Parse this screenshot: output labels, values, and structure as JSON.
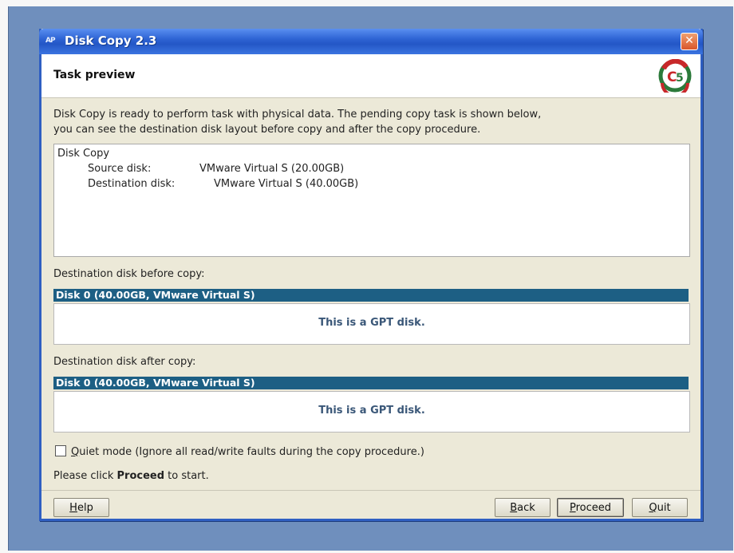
{
  "window": {
    "title": "Disk Copy 2.3",
    "icon_text": "AP",
    "close_glyph": "✕"
  },
  "header": {
    "title": "Task preview"
  },
  "intro": {
    "line1": "Disk Copy is ready to perform task with physical data. The pending copy task is shown below,",
    "line2": "you can see the destination disk layout before copy and after the copy procedure."
  },
  "task": {
    "title": "Disk Copy",
    "source_label": "Source disk:",
    "source_value": "VMware Virtual S (20.00GB)",
    "dest_label": "Destination disk:",
    "dest_value": "VMware Virtual S (40.00GB)"
  },
  "before": {
    "label": "Destination disk before copy:",
    "disk": "Disk 0 (40.00GB, VMware Virtual S)",
    "message": "This is a GPT disk."
  },
  "after": {
    "label": "Destination disk after copy:",
    "disk": "Disk 0 (40.00GB, VMware Virtual S)",
    "message": "This is a GPT disk."
  },
  "quiet_mode": {
    "label_q": "Q",
    "label_rest": "uiet mode (Ignore all read/write faults during the copy procedure.)",
    "checked": false
  },
  "prompt": {
    "prefix": "Please click ",
    "bold": "Proceed",
    "suffix": " to start."
  },
  "buttons": {
    "help_u": "H",
    "help_rest": "elp",
    "back_u": "B",
    "back_rest": "ack",
    "proceed_u": "P",
    "proceed_rest": "roceed",
    "quit_u": "Q",
    "quit_rest": "uit"
  },
  "colors": {
    "titlebar": "#2e64d4",
    "disk_bar": "#1d5f84",
    "disk_message": "#3a5778",
    "dialog_bg": "#ece9d8"
  }
}
